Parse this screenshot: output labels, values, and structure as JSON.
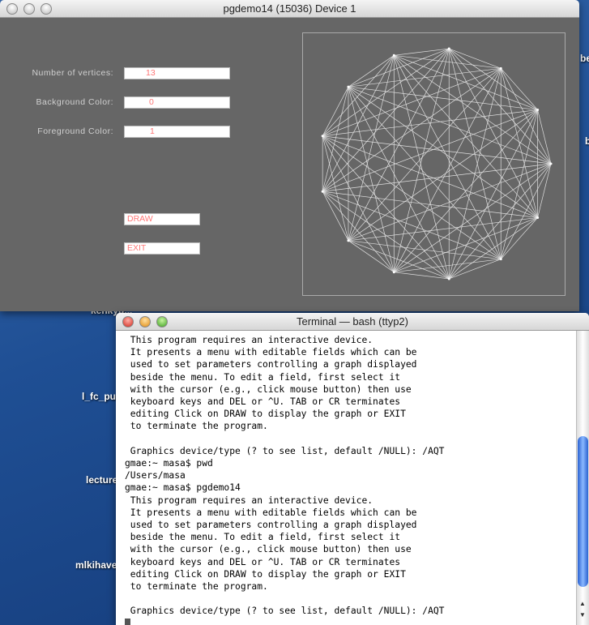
{
  "desktop": {
    "labels": [
      "kenkyu...",
      "l_fc_pu",
      "lecture",
      "mlkihave",
      "be",
      "b"
    ]
  },
  "pgwindow": {
    "title": "pgdemo14 (15036) Device 1",
    "fields": [
      {
        "label": "Number of vertices:",
        "value": "13"
      },
      {
        "label": "Background Color:",
        "value": "0"
      },
      {
        "label": "Foreground Color:",
        "value": "1"
      }
    ],
    "draw_label": "DRAW",
    "exit_label": "EXIT",
    "graph": {
      "vertices": 13,
      "type": "complete-graph",
      "color": "#e0e0e0"
    }
  },
  "terminal": {
    "title": "Terminal — bash (ttyp2)",
    "text": " This program requires an interactive device.\n It presents a menu with editable fields which can be\n used to set parameters controlling a graph displayed\n beside the menu. To edit a field, first select it\n with the cursor (e.g., click mouse button) then use\n keyboard keys and DEL or ^U. TAB or CR terminates\n editing Click on DRAW to display the graph or EXIT\n to terminate the program.\n\n Graphics device/type (? to see list, default /NULL): /AQT\ngmae:~ masa$ pwd\n/Users/masa\ngmae:~ masa$ pgdemo14\n This program requires an interactive device.\n It presents a menu with editable fields which can be\n used to set parameters controlling a graph displayed\n beside the menu. To edit a field, first select it\n with the cursor (e.g., click mouse button) then use\n keyboard keys and DEL or ^U. TAB or CR terminates\n editing Click on DRAW to display the graph or EXIT\n to terminate the program.\n\n Graphics device/type (? to see list, default /NULL): /AQT\n",
    "scroll_position": 0.85
  }
}
